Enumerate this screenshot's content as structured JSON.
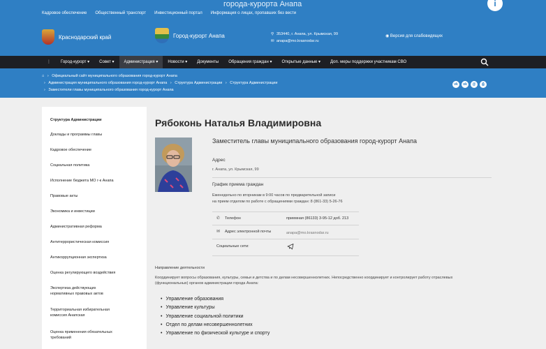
{
  "header": {
    "top_title": "города-курорта Анапа",
    "top_links": [
      "Кадровое обеспечение",
      "Общественный транспорт",
      "Инвестиционный портал",
      "Информация о лицах, пропавших без вести"
    ],
    "logo1_title": "Краснодарский край",
    "logo2_title": "Город-курорт Анапа",
    "address": "353440, г. Анапа, ул. Крымская, 99",
    "email": "anapa@mo.krasnodar.ru",
    "vision_label": "Версия для слабовидящих"
  },
  "nav": {
    "items": [
      "Город-курорт",
      "Совет",
      "Администрация",
      "Новости",
      "Документы",
      "Обращения граждан",
      "Открытые данные",
      "Доп. меры поддержки участникам СВО"
    ]
  },
  "breadcrumb": {
    "home": "Официальный сайт муниципального образования город-курорт Анапа",
    "level2": [
      "Администрация муниципального образования город-курорт Анапа",
      "Структура Администрации",
      "Структура Администрации"
    ],
    "level3": "Заместители главы муниципального образования город-курорт Анапа"
  },
  "social_icons": [
    "vk-icon",
    "ok-icon",
    "email-icon",
    "print-icon"
  ],
  "sidebar": {
    "items": [
      "Структура Администрации",
      "Доклады и программы главы",
      "Кадровое обеспечение",
      "Социальная политика",
      "Исполнение бюджета МО г-к Анапа",
      "Правовые акты",
      "Экономика и инвестиции",
      "Административная реформа",
      "Антитеррористическая комиссия",
      "Антикоррупционная экспертиза",
      "Оценка регулирующего воздействия",
      "Экспертиза действующих нормативных правовых актов",
      "Территориальная избирательная комиссия Анапская",
      "Оценка применения обязательных требований"
    ]
  },
  "person": {
    "name": "Рябоконь Наталья Владимировна",
    "position": "Заместитель главы муниципального образования город-курорт Анапа",
    "address_label": "Адрес",
    "address": "г. Анапа, ул. Крымская, 99",
    "schedule_label": "График приема граждан",
    "schedule_line1": "Еженедельно по вторникам в 9:00 часов по предварительной записи",
    "schedule_line2": "на прием отделом по работе с обращениями граждан: 8 (861-33) 5-26-76",
    "phone_label": "Телефон",
    "phone": "приемная (86133) 3-95-12 доб. 213",
    "email_label": "Адрес электронной почты",
    "email": "anapa@mo.krasnodar.ru",
    "social_label": "Социальные сети:"
  },
  "activity": {
    "title": "Направление деятельности",
    "text": "Координирует вопросы образования, культуры, семьи и детства и по делам несовершеннолетних. Непосредственно координирует и контролирует работу отраслевых (функциональных) органов администрации города Анапа:",
    "departments": [
      "Управление образования",
      "Управление культуры",
      "Управление социальной политики",
      "Отдел по делам несовершеннолетних",
      "Управление по физической культуре и спорту"
    ]
  }
}
